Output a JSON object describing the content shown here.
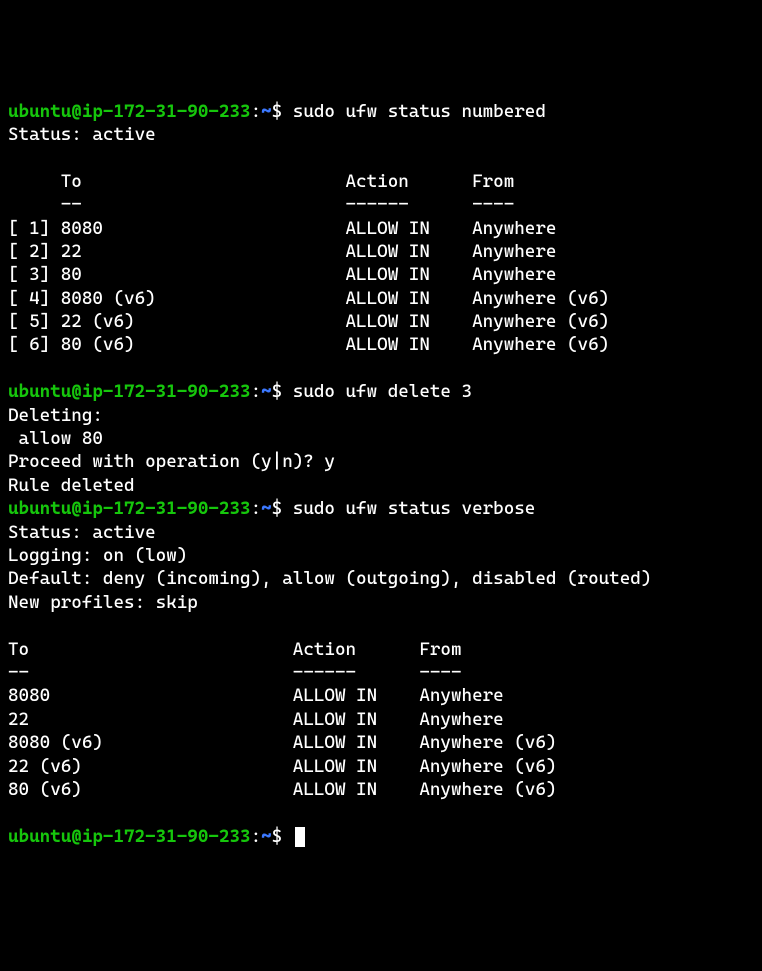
{
  "prompt": {
    "user": "ubuntu",
    "at": "@",
    "host": "ip-172-31-90-233",
    "colon": ":",
    "path": "~",
    "dollar": "$ "
  },
  "blocks": [
    {
      "command": "sudo ufw status numbered",
      "output": [
        "Status: active",
        "",
        "     To                         Action      From",
        "     --                         ------      ----",
        "[ 1] 8080                       ALLOW IN    Anywhere",
        "[ 2] 22                         ALLOW IN    Anywhere",
        "[ 3] 80                         ALLOW IN    Anywhere",
        "[ 4] 8080 (v6)                  ALLOW IN    Anywhere (v6)",
        "[ 5] 22 (v6)                    ALLOW IN    Anywhere (v6)",
        "[ 6] 80 (v6)                    ALLOW IN    Anywhere (v6)",
        ""
      ]
    },
    {
      "command": "sudo ufw delete 3",
      "output": [
        "Deleting:",
        " allow 80",
        "Proceed with operation (y|n)? y",
        "Rule deleted"
      ]
    },
    {
      "command": "sudo ufw status verbose",
      "output": [
        "Status: active",
        "Logging: on (low)",
        "Default: deny (incoming), allow (outgoing), disabled (routed)",
        "New profiles: skip",
        "",
        "To                         Action      From",
        "--                         ------      ----",
        "8080                       ALLOW IN    Anywhere",
        "22                         ALLOW IN    Anywhere",
        "8080 (v6)                  ALLOW IN    Anywhere (v6)",
        "22 (v6)                    ALLOW IN    Anywhere (v6)",
        "80 (v6)                    ALLOW IN    Anywhere (v6)",
        ""
      ]
    }
  ]
}
